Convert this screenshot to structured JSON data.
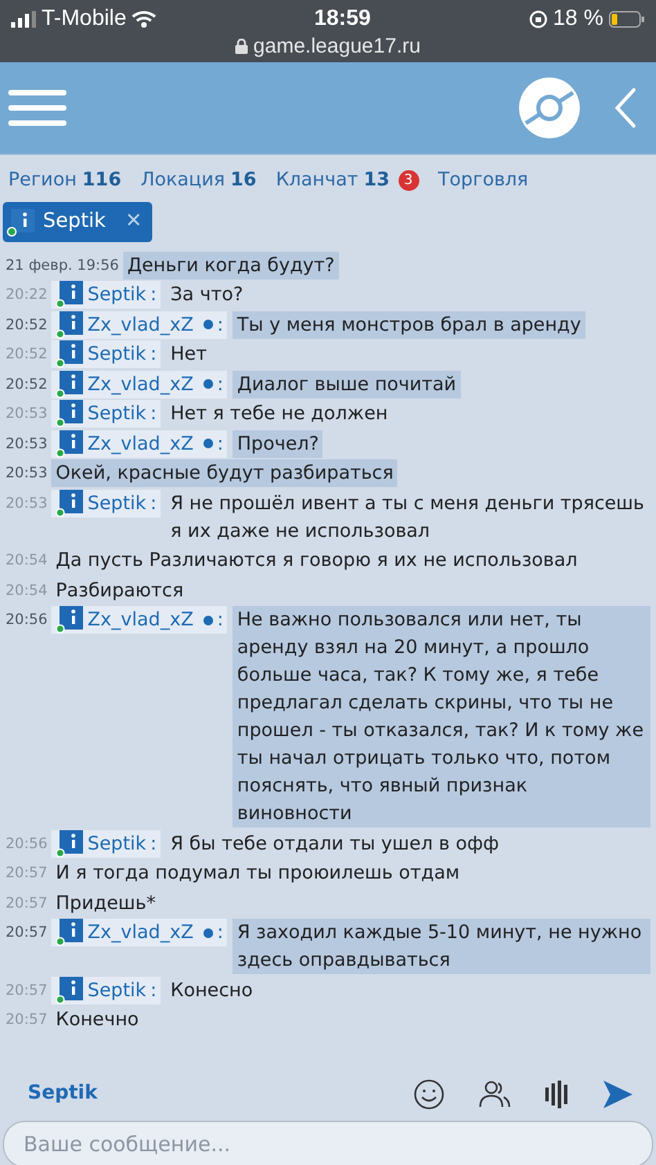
{
  "status_bar": {
    "carrier": "T-Mobile",
    "time": "18:59",
    "battery": "18 %",
    "url": "game.league17.ru"
  },
  "tabs": [
    {
      "label": "Регион",
      "count": "116"
    },
    {
      "label": "Локация",
      "count": "16"
    },
    {
      "label": "Кланчат",
      "count": "13",
      "badge": "3"
    },
    {
      "label": "Торговля"
    }
  ],
  "open_chat": {
    "name": "Septik",
    "close": "✕"
  },
  "messages": [
    {
      "time": "21 февр. 19:56",
      "text": "Деньги когда будут?",
      "highlighted": true
    },
    {
      "time": "20:22",
      "sender": "Septik",
      "status_dot": false,
      "colon": ":",
      "text": "За что?",
      "highlighted": false
    },
    {
      "time": "20:52",
      "sender": "Zx_vlad_xZ",
      "status_dot": true,
      "colon": ":",
      "text": "Ты у меня монстров брал в аренду",
      "highlighted": true
    },
    {
      "time": "20:52",
      "sender": "Septik",
      "status_dot": false,
      "colon": ":",
      "text": "Нет",
      "highlighted": false
    },
    {
      "time": "20:52",
      "sender": "Zx_vlad_xZ",
      "status_dot": true,
      "colon": ":",
      "text": "Диалог выше почитай",
      "highlighted": true
    },
    {
      "time": "20:53",
      "sender": "Septik",
      "status_dot": false,
      "colon": ":",
      "text": "Нет я тебе не должен",
      "highlighted": false
    },
    {
      "time": "20:53",
      "sender": "Zx_vlad_xZ",
      "status_dot": true,
      "colon": ":",
      "text": "Прочел?",
      "highlighted": true
    },
    {
      "time": "20:53",
      "text": "Окей, красные будут разбираться",
      "highlighted": true
    },
    {
      "time": "20:53",
      "sender": "Septik",
      "status_dot": false,
      "colon": ":",
      "text": "Я не прошёл ивент а ты с меня деньги трясешь я их даже не использовал",
      "highlighted": false
    },
    {
      "time": "20:54",
      "text": "Да пусть Различаются я говорю я их не использовал",
      "highlighted": false
    },
    {
      "time": "20:54",
      "text": "Разбираются",
      "highlighted": false
    },
    {
      "time": "20:56",
      "sender": "Zx_vlad_xZ",
      "status_dot": true,
      "colon": ":",
      "text": "Не важно пользовался или нет, ты аренду взял на 20 минут, а прошло больше часа, так? К тому же, я тебе предлагал сделать скрины, что ты не прошел - ты отказался, так? И к тому же ты начал отрицать только что, потом пояснять, что явный признак виновности",
      "highlighted": true
    },
    {
      "time": "20:56",
      "sender": "Septik",
      "status_dot": false,
      "colon": ":",
      "text": "Я бы тебе отдали ты ушел в офф",
      "highlighted": false
    },
    {
      "time": "20:57",
      "text": "И я тогда подумал ты проюилешь отдам",
      "highlighted": false
    },
    {
      "time": "20:57",
      "text": "Придешь*",
      "highlighted": false
    },
    {
      "time": "20:57",
      "sender": "Zx_vlad_xZ",
      "status_dot": true,
      "colon": ":",
      "text": "Я заходил каждые 5-10 минут, не нужно здесь оправдываться",
      "highlighted": true
    },
    {
      "time": "20:57",
      "sender": "Septik",
      "status_dot": false,
      "colon": ":",
      "text": "Конесно",
      "highlighted": false
    },
    {
      "time": "20:57",
      "text": "Конечно",
      "highlighted": false
    }
  ],
  "composer": {
    "recipient": "Septik",
    "placeholder": "Ваше сообщение..."
  }
}
